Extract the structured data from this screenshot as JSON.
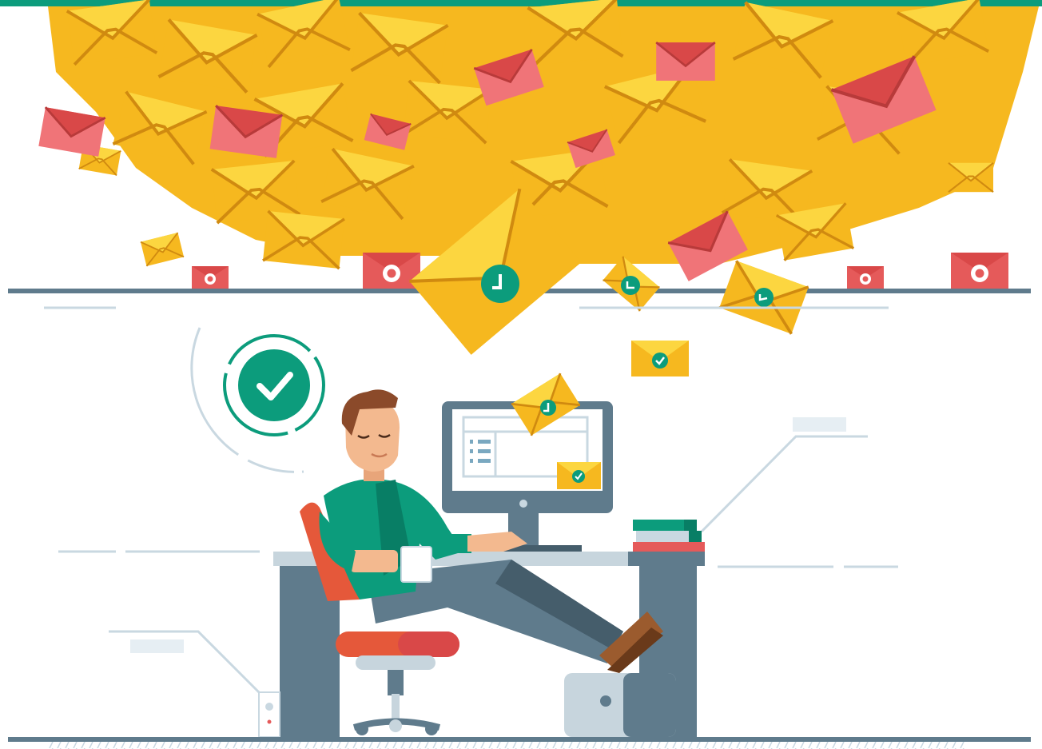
{
  "illustration": {
    "colors": {
      "accent_green": "#0c9c7c",
      "dark_green": "#087e65",
      "envelope_yellow": "#f6b81f",
      "envelope_light": "#fcd640",
      "envelope_shadow": "#d08a10",
      "spam_red": "#e55a5a",
      "spam_light": "#f07478",
      "shelf_gray": "#5f7b8c",
      "desk_light": "#c7d5dd",
      "chair_orange": "#e5583a",
      "line_pale": "#c9d8e1"
    },
    "icons": {
      "status_badge": "check-circle-icon",
      "pending_badge": "clock-icon",
      "spam_badge": "blocked-icon",
      "delivered_badge": "check-icon"
    },
    "screen_panel_rows": 3
  }
}
